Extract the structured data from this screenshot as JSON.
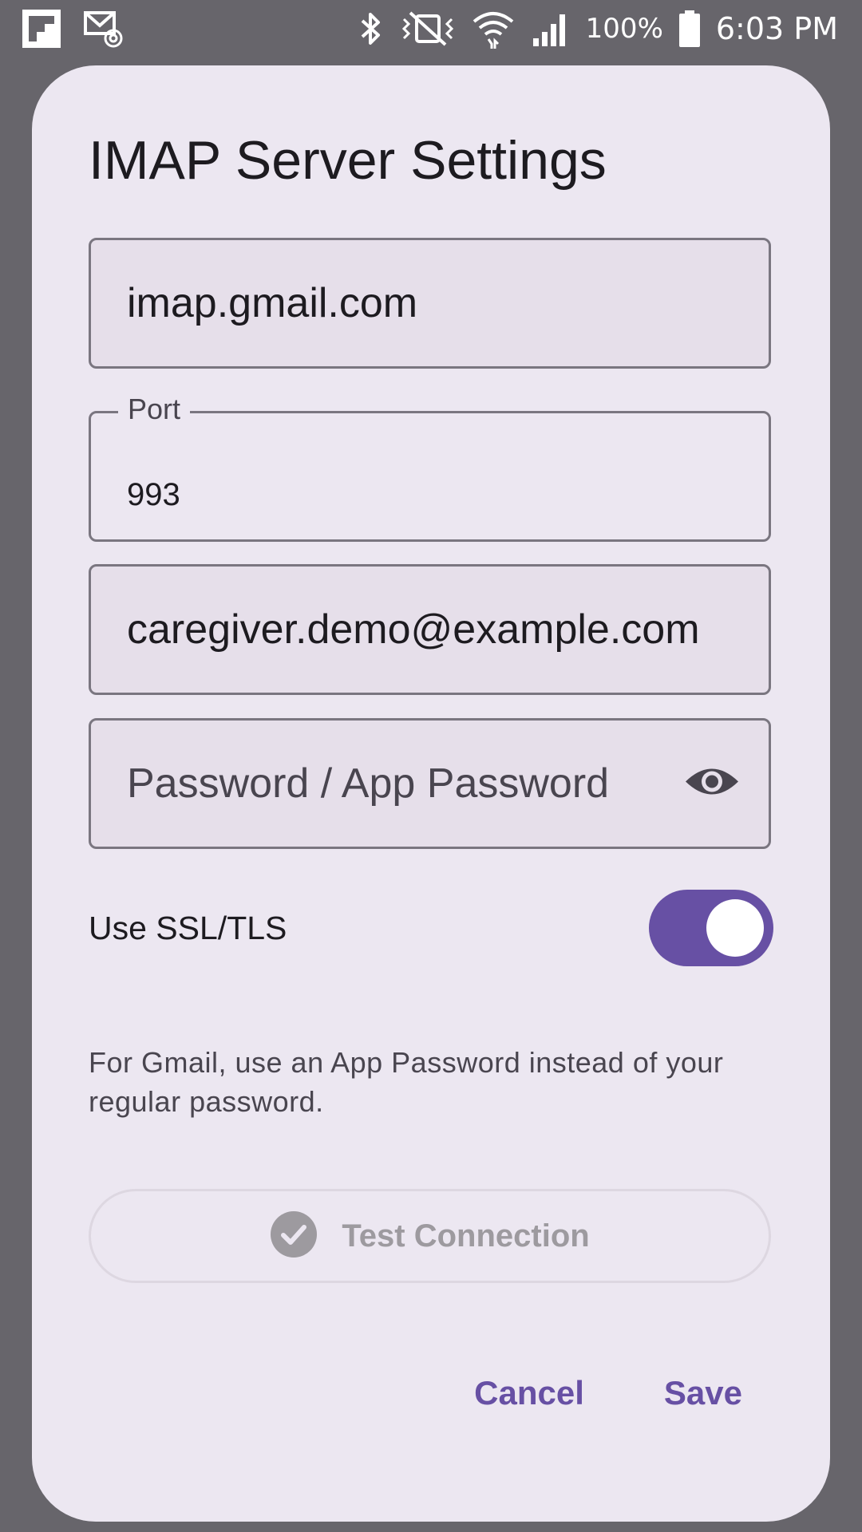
{
  "status_bar": {
    "battery_percent": "100%",
    "time": "6:03 PM",
    "icons": [
      "flipboard-icon",
      "email-at-icon",
      "bluetooth-icon",
      "vibrate-muted-icon",
      "wifi-icon",
      "signal-icon",
      "battery-icon"
    ]
  },
  "dialog": {
    "title": "IMAP Server Settings",
    "server_field": {
      "value": "imap.gmail.com"
    },
    "port_field": {
      "label": "Port",
      "value": "993"
    },
    "username_field": {
      "value": "caregiver.demo@example.com"
    },
    "password_field": {
      "placeholder": "Password / App Password",
      "icon": "eye-icon"
    },
    "ssl_toggle": {
      "label": "Use SSL/TLS",
      "on": true
    },
    "hint": "For Gmail, use an App Password instead of your regular password.",
    "test_button": {
      "label": "Test Connection",
      "icon": "check-circle-icon",
      "enabled": false
    },
    "cancel_label": "Cancel",
    "save_label": "Save"
  },
  "colors": {
    "scrim": "#67656b",
    "dialog_bg": "#ece7f1",
    "field_bg": "#e6dfea",
    "accent": "#6750a4",
    "disabled": "#9d9a9f"
  }
}
